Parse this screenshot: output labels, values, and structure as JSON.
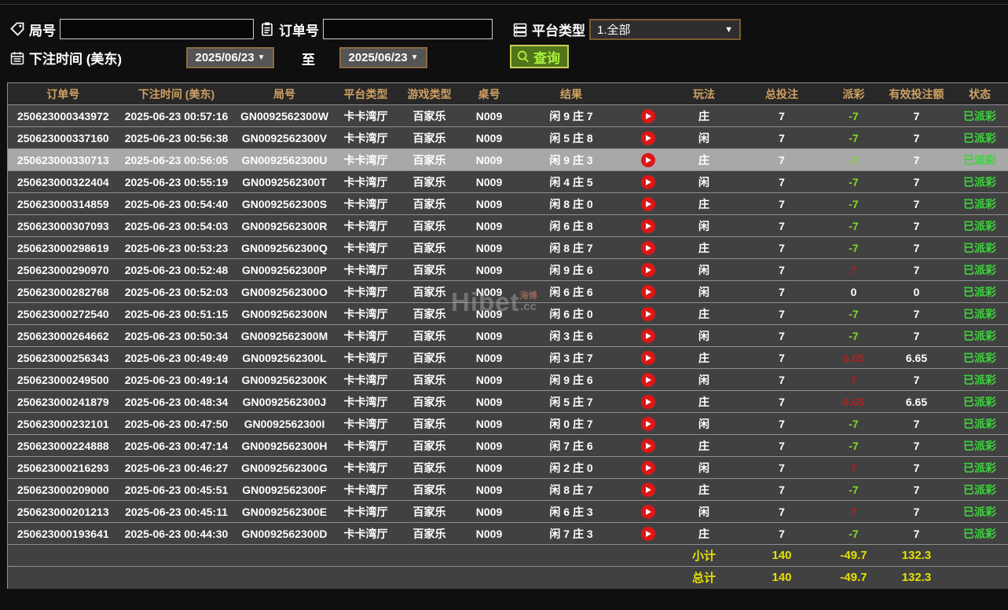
{
  "filters": {
    "round": {
      "label": "局号",
      "value": "",
      "icon": "tag-icon"
    },
    "order": {
      "label": "订单号",
      "value": "",
      "icon": "clipboard-icon"
    },
    "platform": {
      "label": "平台类型",
      "value": "1.全部",
      "icon": "server-icon"
    },
    "bet_time": {
      "label": "下注时间 (美东)",
      "icon": "calendar-icon"
    },
    "date_from": "2025/06/23",
    "date_to": "2025/06/23",
    "to_label": "至",
    "query_button": "查询"
  },
  "table": {
    "headers": [
      "订单号",
      "下注时间 (美东)",
      "局号",
      "平台类型",
      "游戏类型",
      "桌号",
      "结果",
      "",
      "玩法",
      "总投注",
      "派彩",
      "有效投注额",
      "状态"
    ],
    "rows": [
      {
        "order_id": "250623000343972",
        "bet_time": "2025-06-23 00:57:16",
        "round_id": "GN0092562300W",
        "platform": "卡卡湾厅",
        "game": "百家乐",
        "table_no": "N009",
        "result": "闲 9 庄 7",
        "play": "庄",
        "total_bet": "7",
        "payout": "-7",
        "payout_type": "neg",
        "valid_bet": "7",
        "status": "已派彩",
        "highlighted": false
      },
      {
        "order_id": "250623000337160",
        "bet_time": "2025-06-23 00:56:38",
        "round_id": "GN0092562300V",
        "platform": "卡卡湾厅",
        "game": "百家乐",
        "table_no": "N009",
        "result": "闲 5 庄 8",
        "play": "闲",
        "total_bet": "7",
        "payout": "-7",
        "payout_type": "neg",
        "valid_bet": "7",
        "status": "已派彩",
        "highlighted": false
      },
      {
        "order_id": "250623000330713",
        "bet_time": "2025-06-23 00:56:05",
        "round_id": "GN0092562300U",
        "platform": "卡卡湾厅",
        "game": "百家乐",
        "table_no": "N009",
        "result": "闲 9 庄 3",
        "play": "庄",
        "total_bet": "7",
        "payout": "-7",
        "payout_type": "neg",
        "valid_bet": "7",
        "status": "已派彩",
        "highlighted": true
      },
      {
        "order_id": "250623000322404",
        "bet_time": "2025-06-23 00:55:19",
        "round_id": "GN0092562300T",
        "platform": "卡卡湾厅",
        "game": "百家乐",
        "table_no": "N009",
        "result": "闲 4 庄 5",
        "play": "闲",
        "total_bet": "7",
        "payout": "-7",
        "payout_type": "neg",
        "valid_bet": "7",
        "status": "已派彩",
        "highlighted": false
      },
      {
        "order_id": "250623000314859",
        "bet_time": "2025-06-23 00:54:40",
        "round_id": "GN0092562300S",
        "platform": "卡卡湾厅",
        "game": "百家乐",
        "table_no": "N009",
        "result": "闲 8 庄 0",
        "play": "庄",
        "total_bet": "7",
        "payout": "-7",
        "payout_type": "neg",
        "valid_bet": "7",
        "status": "已派彩",
        "highlighted": false
      },
      {
        "order_id": "250623000307093",
        "bet_time": "2025-06-23 00:54:03",
        "round_id": "GN0092562300R",
        "platform": "卡卡湾厅",
        "game": "百家乐",
        "table_no": "N009",
        "result": "闲 6 庄 8",
        "play": "闲",
        "total_bet": "7",
        "payout": "-7",
        "payout_type": "neg",
        "valid_bet": "7",
        "status": "已派彩",
        "highlighted": false
      },
      {
        "order_id": "250623000298619",
        "bet_time": "2025-06-23 00:53:23",
        "round_id": "GN0092562300Q",
        "platform": "卡卡湾厅",
        "game": "百家乐",
        "table_no": "N009",
        "result": "闲 8 庄 7",
        "play": "庄",
        "total_bet": "7",
        "payout": "-7",
        "payout_type": "neg",
        "valid_bet": "7",
        "status": "已派彩",
        "highlighted": false
      },
      {
        "order_id": "250623000290970",
        "bet_time": "2025-06-23 00:52:48",
        "round_id": "GN0092562300P",
        "platform": "卡卡湾厅",
        "game": "百家乐",
        "table_no": "N009",
        "result": "闲 9 庄 6",
        "play": "闲",
        "total_bet": "7",
        "payout": "7",
        "payout_type": "pos",
        "valid_bet": "7",
        "status": "已派彩",
        "highlighted": false
      },
      {
        "order_id": "250623000282768",
        "bet_time": "2025-06-23 00:52:03",
        "round_id": "GN0092562300O",
        "platform": "卡卡湾厅",
        "game": "百家乐",
        "table_no": "N009",
        "result": "闲 6 庄 6",
        "play": "闲",
        "total_bet": "7",
        "payout": "0",
        "payout_type": "zero",
        "valid_bet": "0",
        "status": "已派彩",
        "highlighted": false
      },
      {
        "order_id": "250623000272540",
        "bet_time": "2025-06-23 00:51:15",
        "round_id": "GN0092562300N",
        "platform": "卡卡湾厅",
        "game": "百家乐",
        "table_no": "N009",
        "result": "闲 6 庄 0",
        "play": "庄",
        "total_bet": "7",
        "payout": "-7",
        "payout_type": "neg",
        "valid_bet": "7",
        "status": "已派彩",
        "highlighted": false
      },
      {
        "order_id": "250623000264662",
        "bet_time": "2025-06-23 00:50:34",
        "round_id": "GN0092562300M",
        "platform": "卡卡湾厅",
        "game": "百家乐",
        "table_no": "N009",
        "result": "闲 3 庄 6",
        "play": "闲",
        "total_bet": "7",
        "payout": "-7",
        "payout_type": "neg",
        "valid_bet": "7",
        "status": "已派彩",
        "highlighted": false
      },
      {
        "order_id": "250623000256343",
        "bet_time": "2025-06-23 00:49:49",
        "round_id": "GN0092562300L",
        "platform": "卡卡湾厅",
        "game": "百家乐",
        "table_no": "N009",
        "result": "闲 3 庄 7",
        "play": "庄",
        "total_bet": "7",
        "payout": "6.65",
        "payout_type": "pos",
        "valid_bet": "6.65",
        "status": "已派彩",
        "highlighted": false
      },
      {
        "order_id": "250623000249500",
        "bet_time": "2025-06-23 00:49:14",
        "round_id": "GN0092562300K",
        "platform": "卡卡湾厅",
        "game": "百家乐",
        "table_no": "N009",
        "result": "闲 9 庄 6",
        "play": "闲",
        "total_bet": "7",
        "payout": "7",
        "payout_type": "pos",
        "valid_bet": "7",
        "status": "已派彩",
        "highlighted": false
      },
      {
        "order_id": "250623000241879",
        "bet_time": "2025-06-23 00:48:34",
        "round_id": "GN0092562300J",
        "platform": "卡卡湾厅",
        "game": "百家乐",
        "table_no": "N009",
        "result": "闲 5 庄 7",
        "play": "庄",
        "total_bet": "7",
        "payout": "6.65",
        "payout_type": "pos",
        "valid_bet": "6.65",
        "status": "已派彩",
        "highlighted": false
      },
      {
        "order_id": "250623000232101",
        "bet_time": "2025-06-23 00:47:50",
        "round_id": "GN0092562300I",
        "platform": "卡卡湾厅",
        "game": "百家乐",
        "table_no": "N009",
        "result": "闲 0 庄 7",
        "play": "闲",
        "total_bet": "7",
        "payout": "-7",
        "payout_type": "neg",
        "valid_bet": "7",
        "status": "已派彩",
        "highlighted": false
      },
      {
        "order_id": "250623000224888",
        "bet_time": "2025-06-23 00:47:14",
        "round_id": "GN0092562300H",
        "platform": "卡卡湾厅",
        "game": "百家乐",
        "table_no": "N009",
        "result": "闲 7 庄 6",
        "play": "庄",
        "total_bet": "7",
        "payout": "-7",
        "payout_type": "neg",
        "valid_bet": "7",
        "status": "已派彩",
        "highlighted": false
      },
      {
        "order_id": "250623000216293",
        "bet_time": "2025-06-23 00:46:27",
        "round_id": "GN0092562300G",
        "platform": "卡卡湾厅",
        "game": "百家乐",
        "table_no": "N009",
        "result": "闲 2 庄 0",
        "play": "闲",
        "total_bet": "7",
        "payout": "7",
        "payout_type": "pos",
        "valid_bet": "7",
        "status": "已派彩",
        "highlighted": false
      },
      {
        "order_id": "250623000209000",
        "bet_time": "2025-06-23 00:45:51",
        "round_id": "GN0092562300F",
        "platform": "卡卡湾厅",
        "game": "百家乐",
        "table_no": "N009",
        "result": "闲 8 庄 7",
        "play": "庄",
        "total_bet": "7",
        "payout": "-7",
        "payout_type": "neg",
        "valid_bet": "7",
        "status": "已派彩",
        "highlighted": false
      },
      {
        "order_id": "250623000201213",
        "bet_time": "2025-06-23 00:45:11",
        "round_id": "GN0092562300E",
        "platform": "卡卡湾厅",
        "game": "百家乐",
        "table_no": "N009",
        "result": "闲 6 庄 3",
        "play": "闲",
        "total_bet": "7",
        "payout": "7",
        "payout_type": "pos",
        "valid_bet": "7",
        "status": "已派彩",
        "highlighted": false
      },
      {
        "order_id": "250623000193641",
        "bet_time": "2025-06-23 00:44:30",
        "round_id": "GN0092562300D",
        "platform": "卡卡湾厅",
        "game": "百家乐",
        "table_no": "N009",
        "result": "闲 7 庄 3",
        "play": "庄",
        "total_bet": "7",
        "payout": "-7",
        "payout_type": "neg",
        "valid_bet": "7",
        "status": "已派彩",
        "highlighted": false
      }
    ],
    "subtotal": {
      "label": "小计",
      "total_bet": "140",
      "payout": "-49.7",
      "valid_bet": "132.3"
    },
    "total": {
      "label": "总计",
      "total_bet": "140",
      "payout": "-49.7",
      "valid_bet": "132.3"
    }
  },
  "watermark": {
    "brand": "Hibet",
    "cn": "海博",
    "suffix": ".cc"
  },
  "colors": {
    "header-gold": "#cfa163",
    "pay-neg": "#82d822",
    "pay-pos": "#b02020",
    "status-green": "#3ed33e",
    "summary-yellow": "#e6e000",
    "play-red": "#e01515",
    "button-green-text": "#aaf23c",
    "button-green-bg": "#50751b",
    "button-border": "#c9cf52",
    "selected-row": "#a8a8a8"
  }
}
